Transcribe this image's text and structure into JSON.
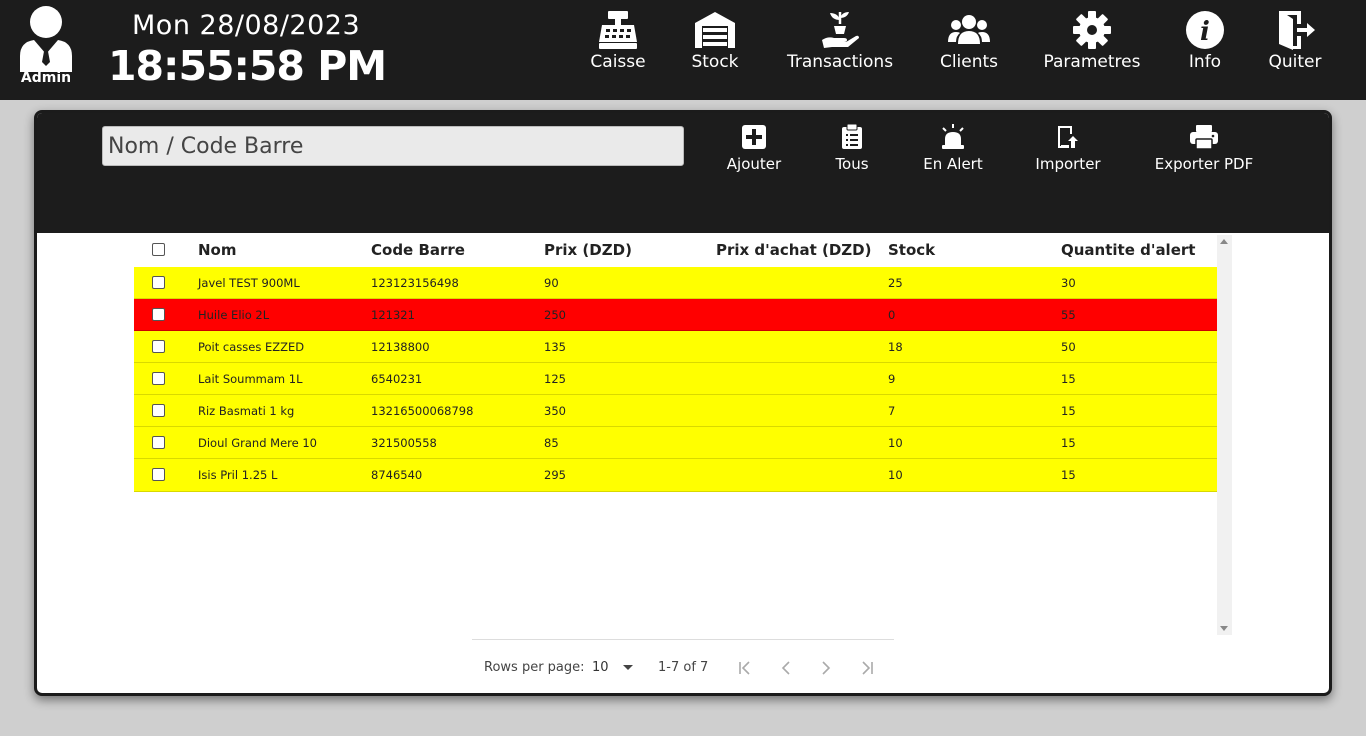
{
  "header": {
    "user_label": "Admin",
    "date": "Mon 28/08/2023",
    "time": "18:55:58 PM"
  },
  "nav": {
    "caisse": "Caisse",
    "stock": "Stock",
    "transactions": "Transactions",
    "clients": "Clients",
    "parametres": "Parametres",
    "info": "Info",
    "quiter": "Quiter"
  },
  "toolbar": {
    "search_placeholder": "Nom / Code Barre",
    "ajouter": "Ajouter",
    "tous": "Tous",
    "en_alert": "En Alert",
    "importer": "Importer",
    "exporter_pdf": "Exporter PDF"
  },
  "table": {
    "columns": [
      "Nom",
      "Code Barre",
      "Prix (DZD)",
      "Prix d'achat (DZD)",
      "Stock",
      "Quantite d'alert"
    ],
    "rows": [
      {
        "nom": "Javel TEST 900ML",
        "code": "123123156498",
        "prix": "90",
        "achat": "",
        "stock": "25",
        "alert": "30",
        "status": "warn"
      },
      {
        "nom": "Huile Elio 2L",
        "code": "121321",
        "prix": "250",
        "achat": "",
        "stock": "0",
        "alert": "55",
        "status": "danger"
      },
      {
        "nom": "Poit casses EZZED",
        "code": "12138800",
        "prix": "135",
        "achat": "",
        "stock": "18",
        "alert": "50",
        "status": "warn"
      },
      {
        "nom": "Lait Soummam 1L",
        "code": "6540231",
        "prix": "125",
        "achat": "",
        "stock": "9",
        "alert": "15",
        "status": "warn"
      },
      {
        "nom": "Riz Basmati 1 kg",
        "code": "13216500068798",
        "prix": "350",
        "achat": "",
        "stock": "7",
        "alert": "15",
        "status": "warn"
      },
      {
        "nom": "Dioul Grand Mere 10",
        "code": "321500558",
        "prix": "85",
        "achat": "",
        "stock": "10",
        "alert": "15",
        "status": "warn"
      },
      {
        "nom": "Isis Pril 1.25 L",
        "code": "8746540",
        "prix": "295",
        "achat": "",
        "stock": "10",
        "alert": "15",
        "status": "warn"
      }
    ]
  },
  "pagination": {
    "rows_per_page_label": "Rows per page:",
    "rows_per_page_value": "10",
    "range": "1-7 of 7"
  },
  "colors": {
    "header_bg": "#1c1c1c",
    "warn_row": "#ffff00",
    "danger_row": "#ff0000"
  }
}
